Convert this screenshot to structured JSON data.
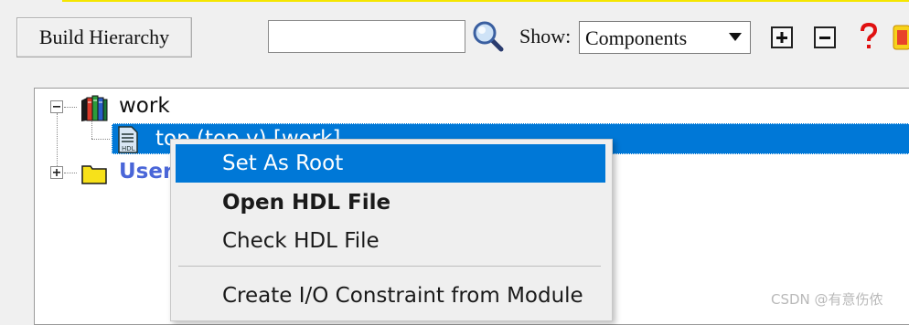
{
  "toolbar": {
    "build_label": "Build Hierarchy",
    "search_value": "",
    "show_label": "Show:",
    "show_selected": "Components",
    "expand_icon": "plus-box-icon",
    "collapse_icon": "minus-box-icon",
    "help_icon": "question-mark-icon"
  },
  "tree": {
    "items": [
      {
        "label": "work",
        "icon": "library-books-icon",
        "expanded": true
      },
      {
        "label": "top (top.v) [work]",
        "icon": "verilog-file-icon",
        "selected": true
      },
      {
        "label": "User",
        "icon": "folder-icon",
        "expanded": false
      }
    ]
  },
  "context_menu": {
    "items": [
      {
        "label": "Set As Root",
        "highlighted": true
      },
      {
        "label": "Open HDL File",
        "bold": true
      },
      {
        "label": "Check HDL File"
      },
      {
        "label": "Create I/O Constraint from Module"
      }
    ]
  },
  "watermark": "CSDN @有意伤侬",
  "colors": {
    "selection": "#0078d7",
    "user_link": "#4a66d8",
    "top_accent": "#f5e600"
  }
}
